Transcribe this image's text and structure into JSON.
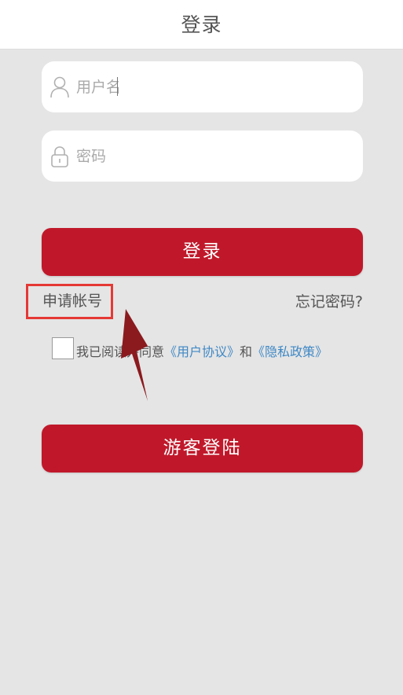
{
  "header": {
    "title": "登录"
  },
  "username": {
    "placeholder": "用户名",
    "icon": "user-icon"
  },
  "password": {
    "placeholder": "密码",
    "icon": "lock-icon"
  },
  "login_button": "登录",
  "register_link": "申请帐号",
  "forgot_link": "忘记密码?",
  "agreement": {
    "prefix": "我已阅读并同意",
    "user_agreement": "《用户协议》",
    "and": "和",
    "privacy_policy": "《隐私政策》",
    "checked": false
  },
  "guest_button": "游客登陆",
  "colors": {
    "primary": "#c0182a",
    "link": "#3f88c5",
    "highlight_box": "#e53935",
    "annotation_arrow": "#8b1a1e",
    "background": "#e5e5e5"
  }
}
